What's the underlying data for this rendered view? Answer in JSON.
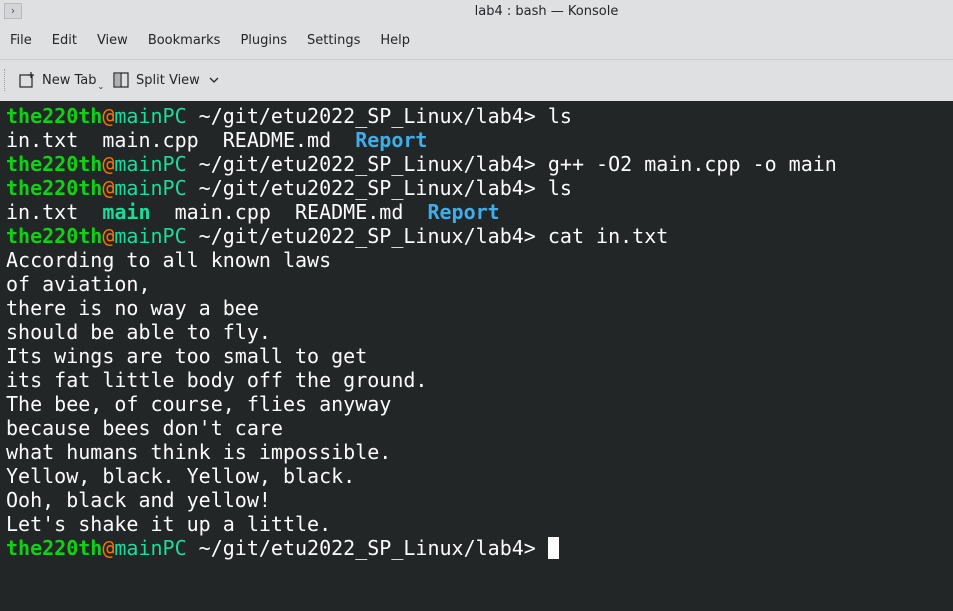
{
  "window": {
    "title": "lab4 : bash — Konsole"
  },
  "menubar": [
    "File",
    "Edit",
    "View",
    "Bookmarks",
    "Plugins",
    "Settings",
    "Help"
  ],
  "toolbar": {
    "new_tab": "New Tab",
    "split_view": "Split View"
  },
  "colors": {
    "terminal_bg": "#232627",
    "user": "#11d116",
    "at": "#f67400",
    "host": "#1cdc9a",
    "dir": "#3daee9"
  },
  "prompt": {
    "user": "the220th",
    "at": "@",
    "host": "mainPC",
    "path": " ~/git/etu2022_SP_Linux/lab4> "
  },
  "commands": {
    "c1": "ls",
    "c2": "g++ -O2 main.cpp -o main",
    "c3": "ls",
    "c4": "cat in.txt"
  },
  "ls1": {
    "a": "in.txt  main.cpp  README.md  ",
    "dir": "Report"
  },
  "ls2": {
    "a": "in.txt  ",
    "exec": "main",
    "b": "  main.cpp  README.md  ",
    "dir": "Report"
  },
  "output": [
    "According to all known laws",
    "of aviation,",
    "there is no way a bee",
    "should be able to fly.",
    "Its wings are too small to get",
    "its fat little body off the ground.",
    "The bee, of course, flies anyway",
    "because bees don't care",
    "what humans think is impossible.",
    "Yellow, black. Yellow, black.",
    "Ooh, black and yellow!",
    "Let's shake it up a little."
  ]
}
